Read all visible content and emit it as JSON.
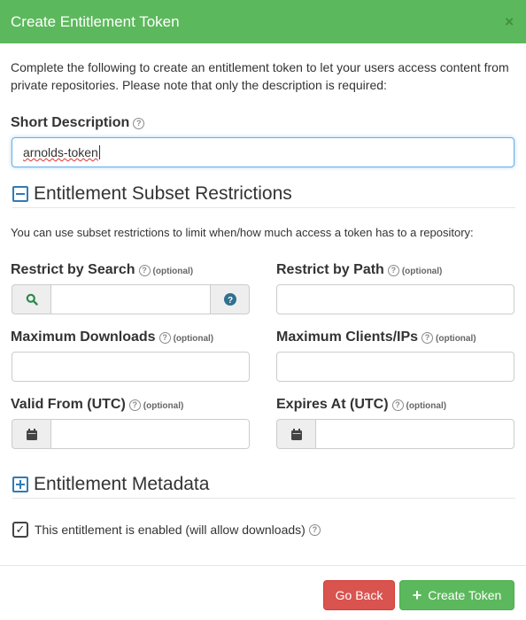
{
  "modal": {
    "title": "Create Entitlement Token",
    "close_label": "×",
    "intro": "Complete the following to create an entitlement token to let your users access content from private repositories. Please note that only the description is required:"
  },
  "short_description": {
    "label": "Short Description",
    "value": "arnolds-token"
  },
  "subset_section": {
    "title": "Entitlement Subset Restrictions",
    "description": "You can use subset restrictions to limit when/how much access a token has to a repository:"
  },
  "fields": {
    "optional_tag": "(optional)",
    "restrict_search": {
      "label": "Restrict by Search",
      "value": ""
    },
    "restrict_path": {
      "label": "Restrict by Path",
      "value": ""
    },
    "max_downloads": {
      "label": "Maximum Downloads",
      "value": ""
    },
    "max_clients": {
      "label": "Maximum Clients/IPs",
      "value": ""
    },
    "valid_from": {
      "label": "Valid From (UTC)",
      "value": ""
    },
    "expires_at": {
      "label": "Expires At (UTC)",
      "value": ""
    }
  },
  "metadata_section": {
    "title": "Entitlement Metadata"
  },
  "enabled": {
    "label": "This entitlement is enabled (will allow downloads)",
    "checked": true
  },
  "buttons": {
    "back": "Go Back",
    "create": "Create Token"
  },
  "colors": {
    "header": "#5cb85c",
    "back_button": "#d9534f",
    "create_button": "#5cb85c",
    "accent": "#337ab7",
    "help_icon": "#31708f"
  },
  "icons": {
    "close": "close-icon",
    "help": "help-circle-icon",
    "search": "search-icon",
    "question": "question-icon",
    "calendar": "calendar-icon",
    "collapse": "minus-square-icon",
    "expand": "plus-square-icon",
    "check": "checkbox-checked-icon",
    "add": "plus-icon"
  }
}
